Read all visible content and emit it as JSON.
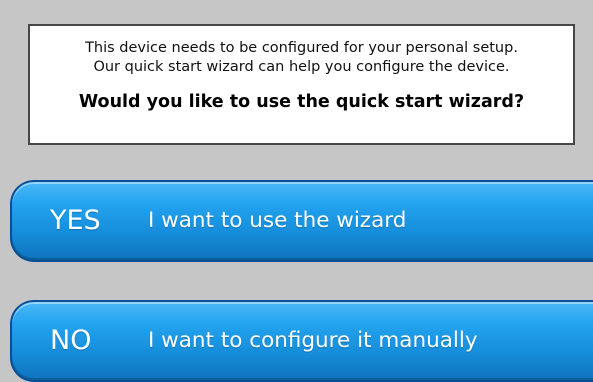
{
  "prompt": {
    "line_1": "This device needs to be configured for your personal setup.",
    "line_2": "Our quick start wizard can help you configure the device.",
    "question": "Would you like to use the quick start wizard?"
  },
  "choices": {
    "yes": {
      "key": "YES",
      "text": "I want to use the wizard"
    },
    "no": {
      "key": "NO",
      "text": "I want to configure it manually"
    }
  },
  "colors": {
    "background": "#c6c6c6",
    "message_box": "#ffffff",
    "message_border": "#474747",
    "button_blue": "#178fdc",
    "button_border": "#0a4f96",
    "button_text": "#ffffff"
  }
}
